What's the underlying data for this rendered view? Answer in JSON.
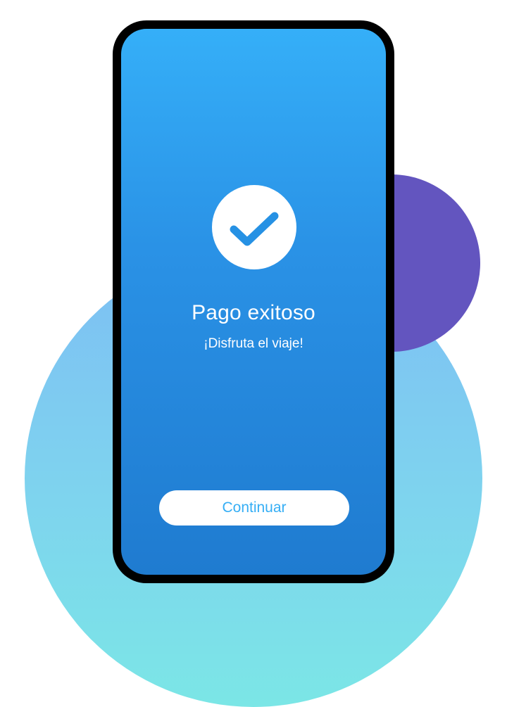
{
  "success": {
    "title": "Pago exitoso",
    "subtitle": "¡Disfruta el viaje!",
    "icon": "check-icon"
  },
  "actions": {
    "continue_label": "Continuar"
  },
  "colors": {
    "screen_top": "#35aff8",
    "screen_bottom": "#1f7bd0",
    "accent_text": "#35aef5",
    "purple_circle": "#6355bf",
    "bg_circle_top": "#7dbef4",
    "bg_circle_bottom": "#7be6e6"
  }
}
